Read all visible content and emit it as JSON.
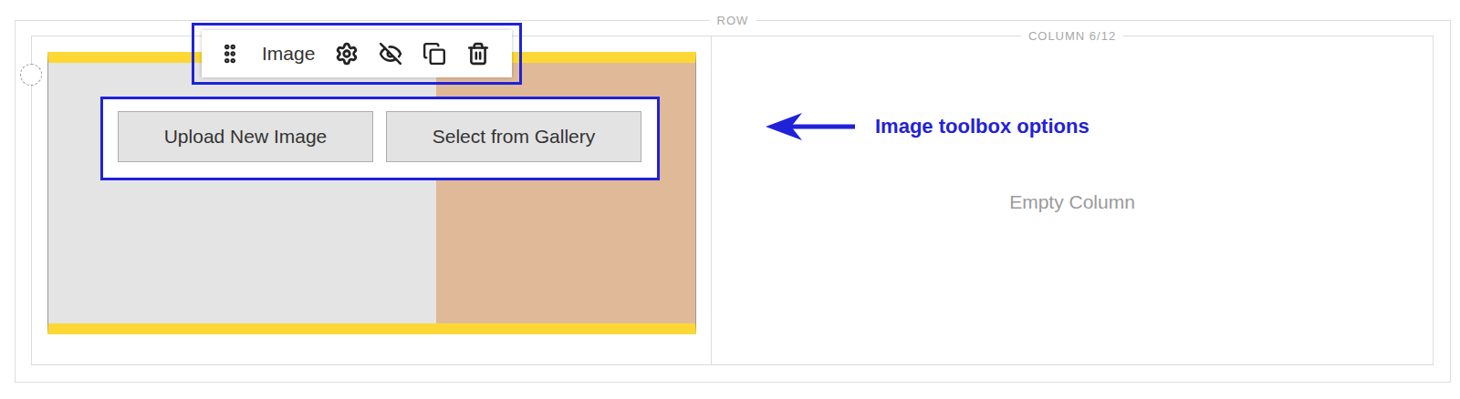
{
  "row": {
    "label": "ROW"
  },
  "column": {
    "label": "COLUMN 6/12"
  },
  "image_toolbar": {
    "title": "Image"
  },
  "image_actions": [
    "Upload New Image",
    "Select from Gallery"
  ],
  "empty_column": {
    "text": "Empty Column"
  },
  "annotation": {
    "text": "Image toolbox options"
  }
}
